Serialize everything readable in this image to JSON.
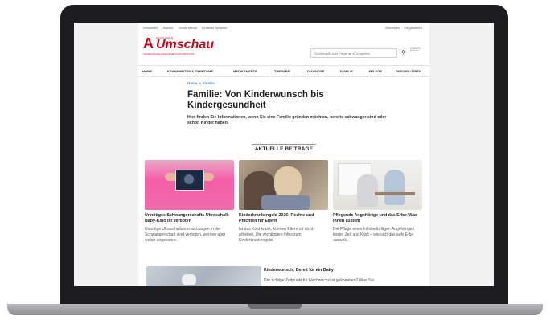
{
  "topbar": {
    "links": [
      "Newsletter",
      "Bücher",
      "Social Media",
      "Einfache Sprache"
    ],
    "right_links": [
      "Anmelden",
      "Registrieren"
    ]
  },
  "logo": {
    "apotheken": "APOTHEKEN",
    "word": "Umschau",
    "tagline": "UNABHÄNGIGE GESUNDHEITSINFORMATION"
  },
  "search": {
    "placeholder": "Suchbegriff oder Frage an KI eingeben",
    "powered_by": "powered by",
    "provider": "pascale"
  },
  "nav": [
    "HOME",
    "KRANKHEITEN & SYMPTOME",
    "MEDIKAMENTE",
    "THERAPIE",
    "DIAGNOSE",
    "FAMILIE",
    "PFLEGE",
    "GESUND LEBEN"
  ],
  "breadcrumb": {
    "home": "Home",
    "sep": ">",
    "current": "Familie"
  },
  "page": {
    "title": "Familie: Von Kinderwunsch bis Kindergesundheit",
    "lead": "Hier finden Sie Informationen, wenn Sie eine Familie gründen möchten, bereits schwanger sind oder schon Kinder haben."
  },
  "section": {
    "title": "AKTUELLE BEITRÄGE"
  },
  "cards": [
    {
      "title": "Unnötiges Schwangerschafts-Ultraschall: Baby-Kino ist verboten",
      "text": "Unnötige Ultraschalluntersuchungen in der Schwangerschaft sind verboten, werden aber weiter angeboten."
    },
    {
      "title": "Kinderkrankengeld 2026: Rechte und Pflichten für Eltern",
      "text": "Ist das Kind krank, können Eltern oft nicht arbeiten. Die wichtigsten Infos zum Kinderkrankengeld."
    },
    {
      "title": "Pflegende Angehörige und das Erbe: Was Ihnen zusteht",
      "text": "Die Pflege eines hilfsbedürftigen Angehörigen kostet Zeit und Kraft – wie sich das aufs Erbe auswirkt."
    }
  ],
  "featured": {
    "title": "Kinderwunsch: Bereit für ein Baby",
    "text": "Der richtige Zeitpunkt für Nachwuchs ist gekommen? Was Sie"
  },
  "colors": {
    "brand_red": "#d0021b",
    "link_blue": "#0b6bc7",
    "laptop_frame": "#1d1d1f"
  }
}
